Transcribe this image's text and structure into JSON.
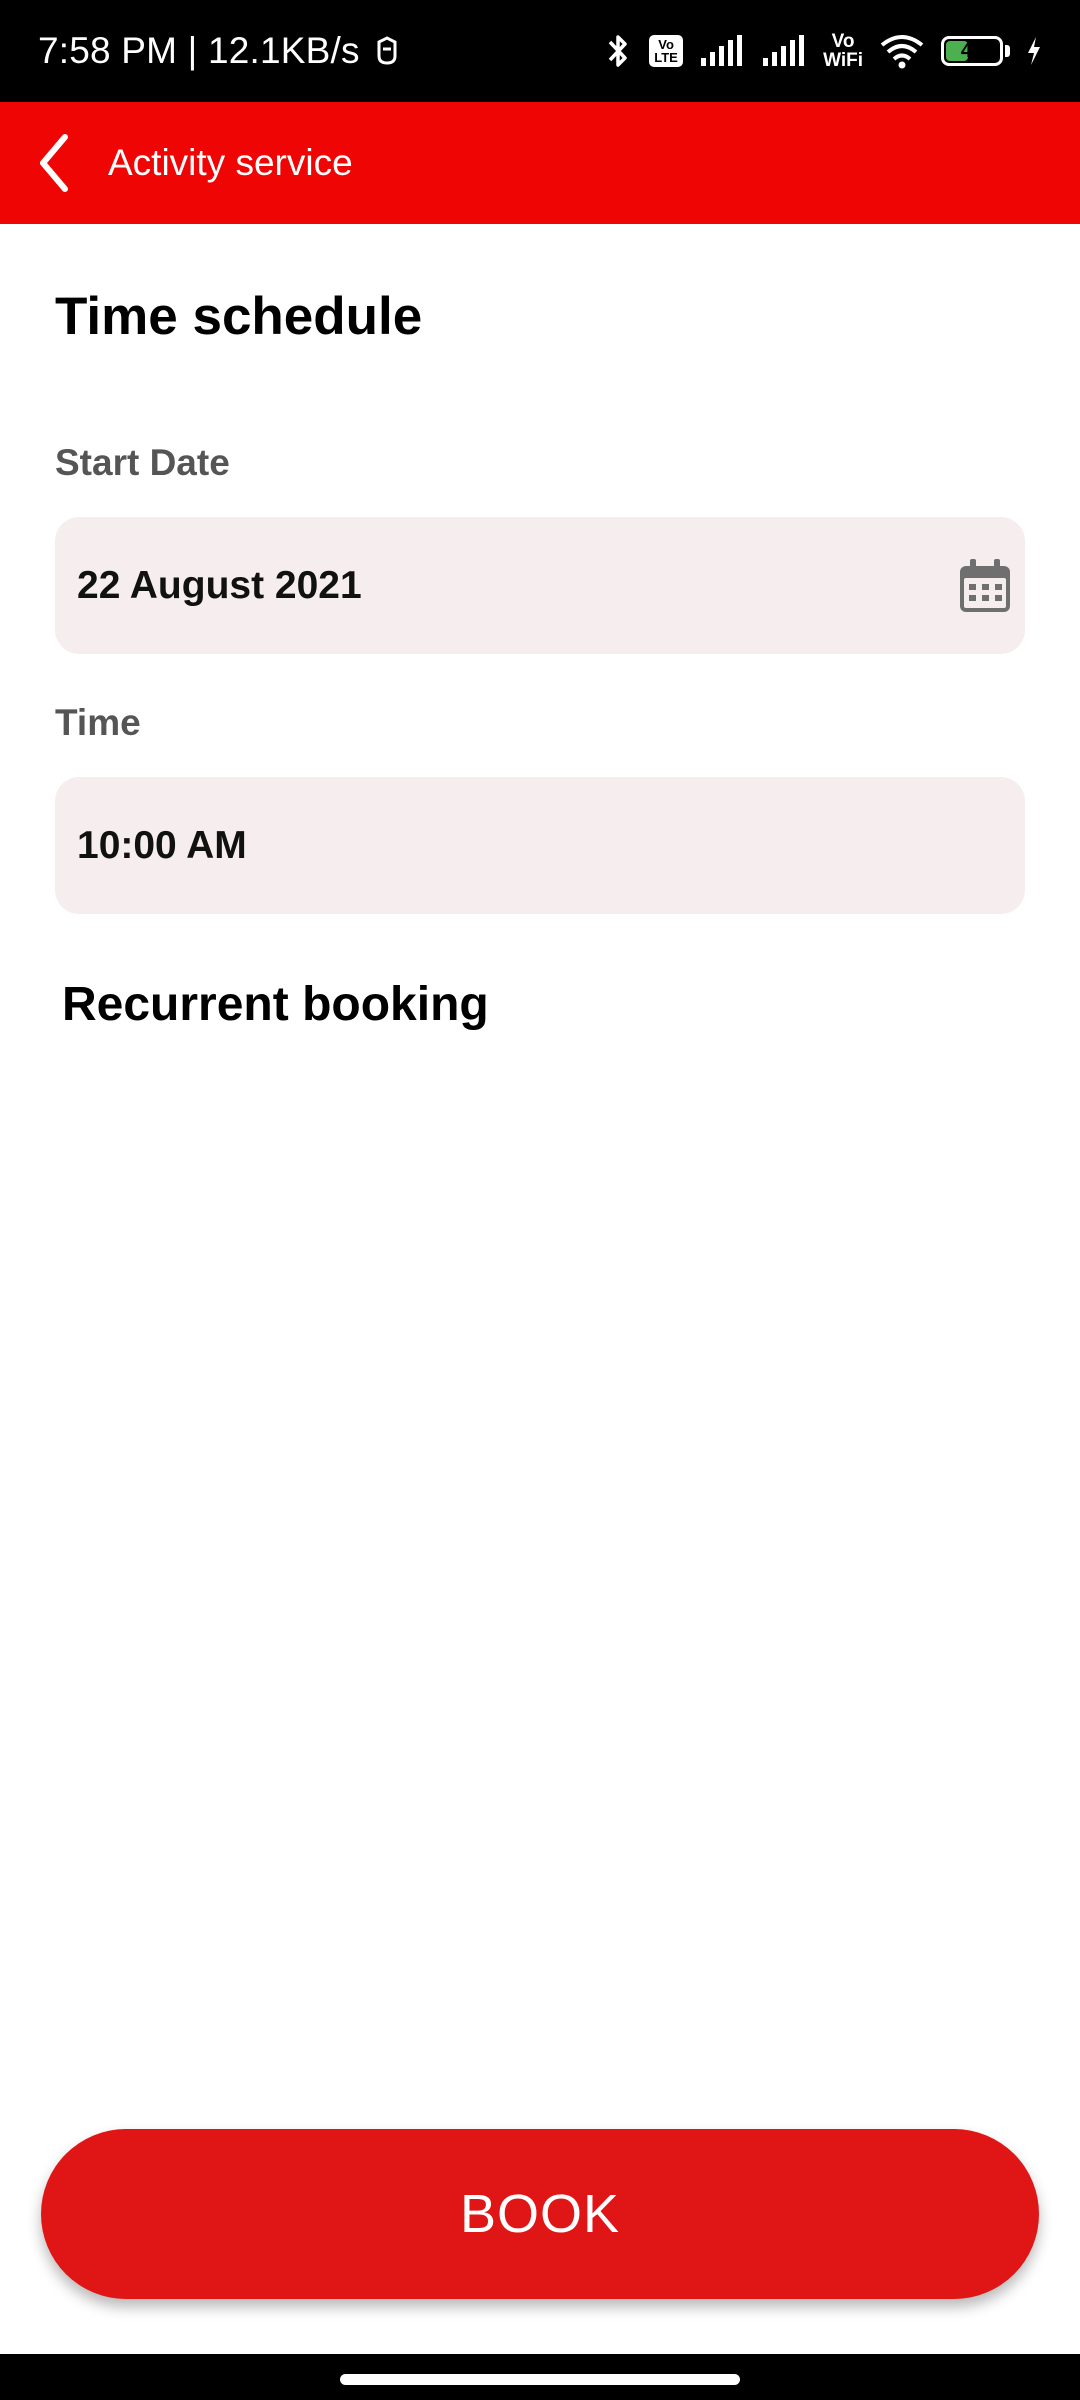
{
  "status_bar": {
    "time_speed": "7:58 PM | 12.1KB/s",
    "volte_label": "Vo\nLTE",
    "vowifi_label": "Vo\nWiFi",
    "battery_level": "46",
    "battery_fraction": 0.46,
    "icons": [
      "notification-app-icon",
      "bluetooth-icon",
      "volte-icon",
      "signal-icon",
      "signal-icon",
      "vowifi-icon",
      "wifi-icon",
      "battery-icon",
      "charging-icon"
    ]
  },
  "app_bar": {
    "title": "Activity service",
    "background": "#f00505"
  },
  "schedule": {
    "title": "Time schedule",
    "start_date_label": "Start Date",
    "start_date_value": "22 August 2021",
    "time_label": "Time",
    "time_value": "10:00 AM",
    "recurrent_title": "Recurrent booking"
  },
  "book_button": {
    "label": "BOOK",
    "color": "#e01515"
  }
}
